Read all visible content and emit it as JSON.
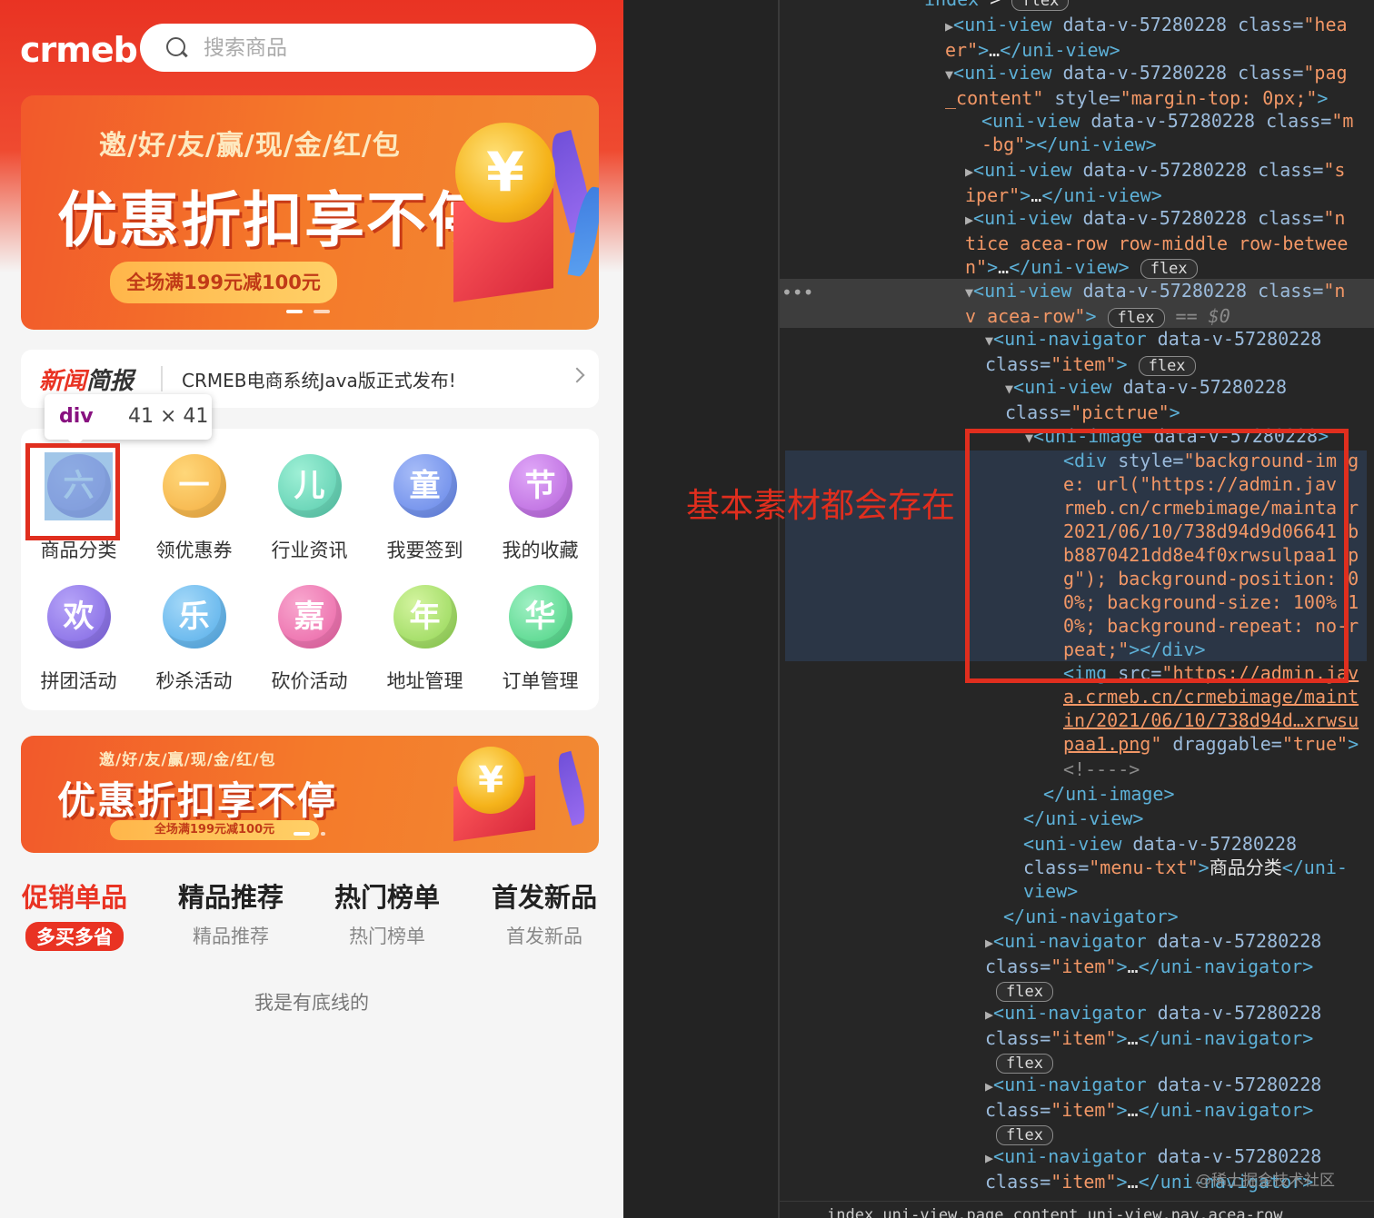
{
  "app": {
    "logo_text": "crmeb",
    "search": {
      "placeholder": "搜索商品"
    },
    "banner": {
      "subtitle": "邀/好/友/赢/现/金/红/包",
      "title": "优惠折扣享不停",
      "promo": "全场满199元减100元",
      "coin_glyph": "¥"
    },
    "news": {
      "tag_red": "新闻",
      "tag_dark": "简报",
      "text": "CRMEB电商系统Java版正式发布!"
    },
    "menu": [
      {
        "icon_char": "六",
        "label": "商品分类",
        "color": "#9a7bd8"
      },
      {
        "icon_char": "一",
        "label": "领优惠券",
        "color": "#f2a93a"
      },
      {
        "icon_char": "儿",
        "label": "行业资讯",
        "color": "#4fc7a8"
      },
      {
        "icon_char": "童",
        "label": "我要签到",
        "color": "#5b7ee6"
      },
      {
        "icon_char": "节",
        "label": "我的收藏",
        "color": "#b25ad8"
      },
      {
        "icon_char": "欢",
        "label": "拼团活动",
        "color": "#7a5ee0"
      },
      {
        "icon_char": "乐",
        "label": "秒杀活动",
        "color": "#4aa8e8"
      },
      {
        "icon_char": "嘉",
        "label": "砍价活动",
        "color": "#e85aa0"
      },
      {
        "icon_char": "年",
        "label": "地址管理",
        "color": "#8ad24a"
      },
      {
        "icon_char": "华",
        "label": "订单管理",
        "color": "#3fcf7a"
      }
    ],
    "inspect_tooltip": {
      "tag": "div",
      "size": "41 × 41"
    },
    "tabs": [
      {
        "title": "促销单品",
        "sub": "多买多省"
      },
      {
        "title": "精品推荐",
        "sub": "精品推荐"
      },
      {
        "title": "热门榜单",
        "sub": "热门榜单"
      },
      {
        "title": "首发新品",
        "sub": "首发新品"
      }
    ],
    "footer": "我是有底线的"
  },
  "devtools": {
    "annotation": "基本素材都会存在",
    "breadcrumb": "index   uni-view.page_content   uni-view.nav.acea-row",
    "watermark": "@稀土掘金技术社区",
    "flex_label": "flex",
    "selected_marker": "== $0"
  },
  "colors": {
    "brand_red": "#e93323",
    "annotation_red": "#e02e1e",
    "devtools_bg": "#262626"
  }
}
